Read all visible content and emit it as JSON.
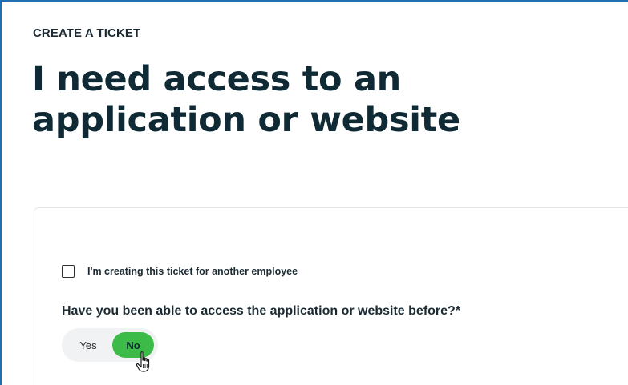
{
  "header": {
    "eyebrow": "CREATE A TICKET",
    "title": "I need access to an application or website"
  },
  "form": {
    "checkbox": {
      "label": "I'm creating this ticket for another employee",
      "checked": false
    },
    "question": {
      "label": "Have you been able to access the application or website before?*",
      "options": [
        {
          "label": "Yes",
          "selected": false
        },
        {
          "label": "No",
          "selected": true
        }
      ]
    }
  },
  "colors": {
    "accent_green": "#3dbb48",
    "frame_border": "#1f6fb2",
    "text_dark": "#0f2a35"
  },
  "icons": {
    "cursor": "hand-pointer-icon"
  }
}
